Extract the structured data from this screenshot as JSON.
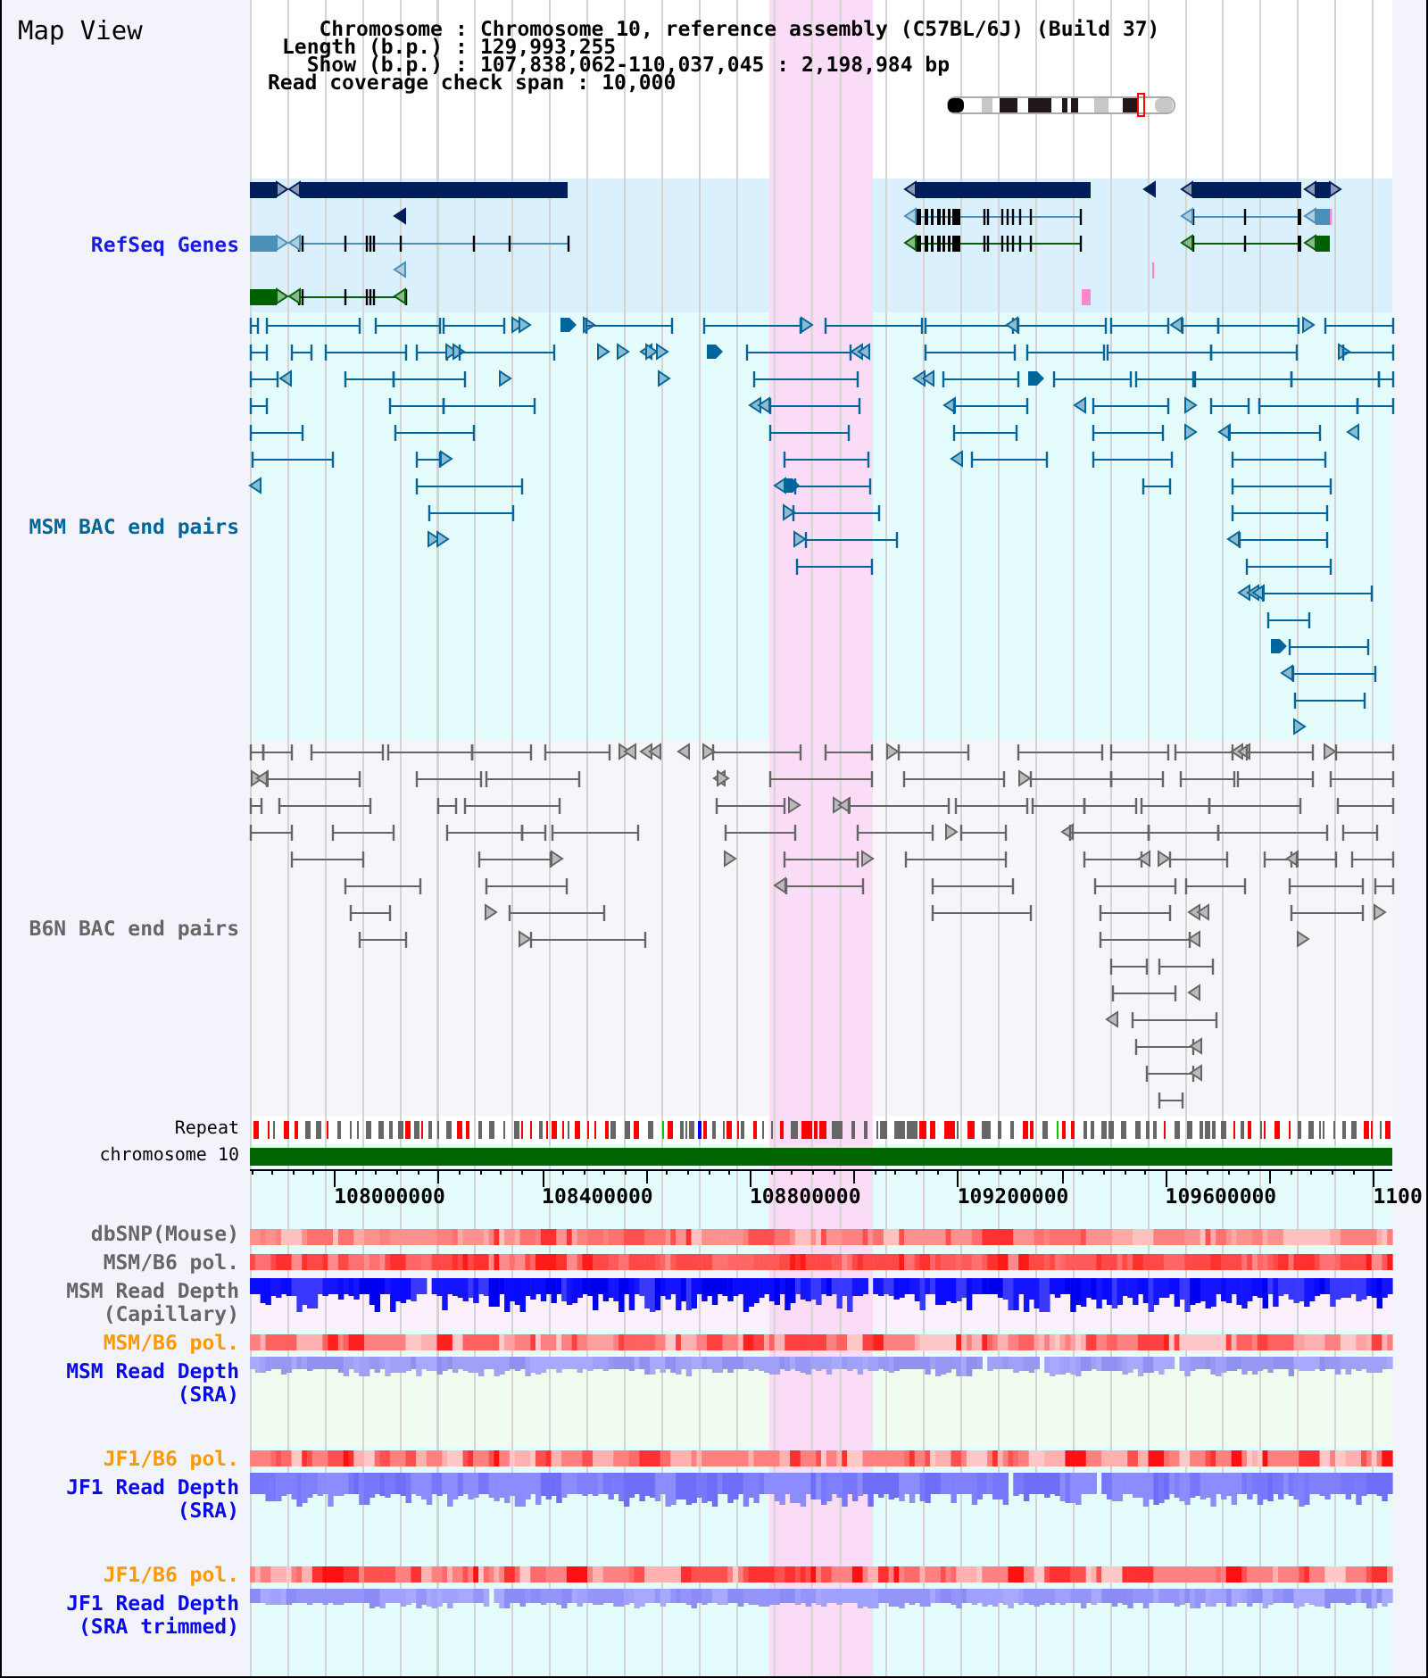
{
  "title": "Map View",
  "info": [
    {
      "label": "Chromosome",
      "separator": ":",
      "value": "Chromosome 10, reference assembly (C57BL/6J) (Build 37)"
    },
    {
      "label": "Length (b.p.)",
      "separator": ":",
      "value": "129,993,255"
    },
    {
      "label": "Show (b.p.)",
      "separator": ":",
      "value": "107,838,062-110,037,045 : 2,198,984 bp"
    }
  ],
  "coverage_span": {
    "label": "Read coverage check span",
    "separator": ":",
    "value": "10,000"
  },
  "tracks": [
    {
      "kind": "genes",
      "label": [
        "RefSeq Genes"
      ],
      "color": "#1a1ae6"
    },
    {
      "kind": "bac_pairs",
      "label": [
        "MSM BAC end pairs"
      ],
      "color": "#006699"
    },
    {
      "kind": "bac_pairs",
      "label": [
        "B6N BAC end pairs"
      ],
      "color": "#666666"
    },
    {
      "kind": "repeat",
      "label": [
        "Repeat"
      ]
    },
    {
      "kind": "chromosome",
      "label": [
        "chromosome 10"
      ]
    },
    {
      "kind": "ruler",
      "ticks": [
        "108000000",
        "108400000",
        "108800000",
        "109200000",
        "109600000",
        "1100"
      ]
    },
    {
      "kind": "heatmap",
      "label": [
        "dbSNP(Mouse)"
      ],
      "color": "#666666"
    },
    {
      "kind": "heatmap",
      "label": [
        "MSM/B6 pol."
      ],
      "color": "#666666"
    },
    {
      "kind": "depth",
      "label": [
        "MSM Read Depth",
        "(Capillary)"
      ],
      "color": "#666666"
    },
    {
      "kind": "heatmap",
      "label": [
        "MSM/B6 pol."
      ],
      "color": "#ff9900"
    },
    {
      "kind": "depth",
      "label": [
        "MSM Read Depth",
        "(SRA)"
      ],
      "color": "#0a0ae6"
    },
    {
      "kind": "heatmap",
      "label": [
        "JF1/B6 pol."
      ],
      "color": "#ff9900"
    },
    {
      "kind": "depth",
      "label": [
        "JF1 Read Depth",
        "(SRA)"
      ],
      "color": "#0a0ae6"
    },
    {
      "kind": "heatmap",
      "label": [
        "JF1/B6 pol."
      ],
      "color": "#ff9900"
    },
    {
      "kind": "depth",
      "label": [
        "JF1 Read Depth",
        "(SRA trimmed)"
      ],
      "color": "#0a0ae6"
    }
  ]
}
